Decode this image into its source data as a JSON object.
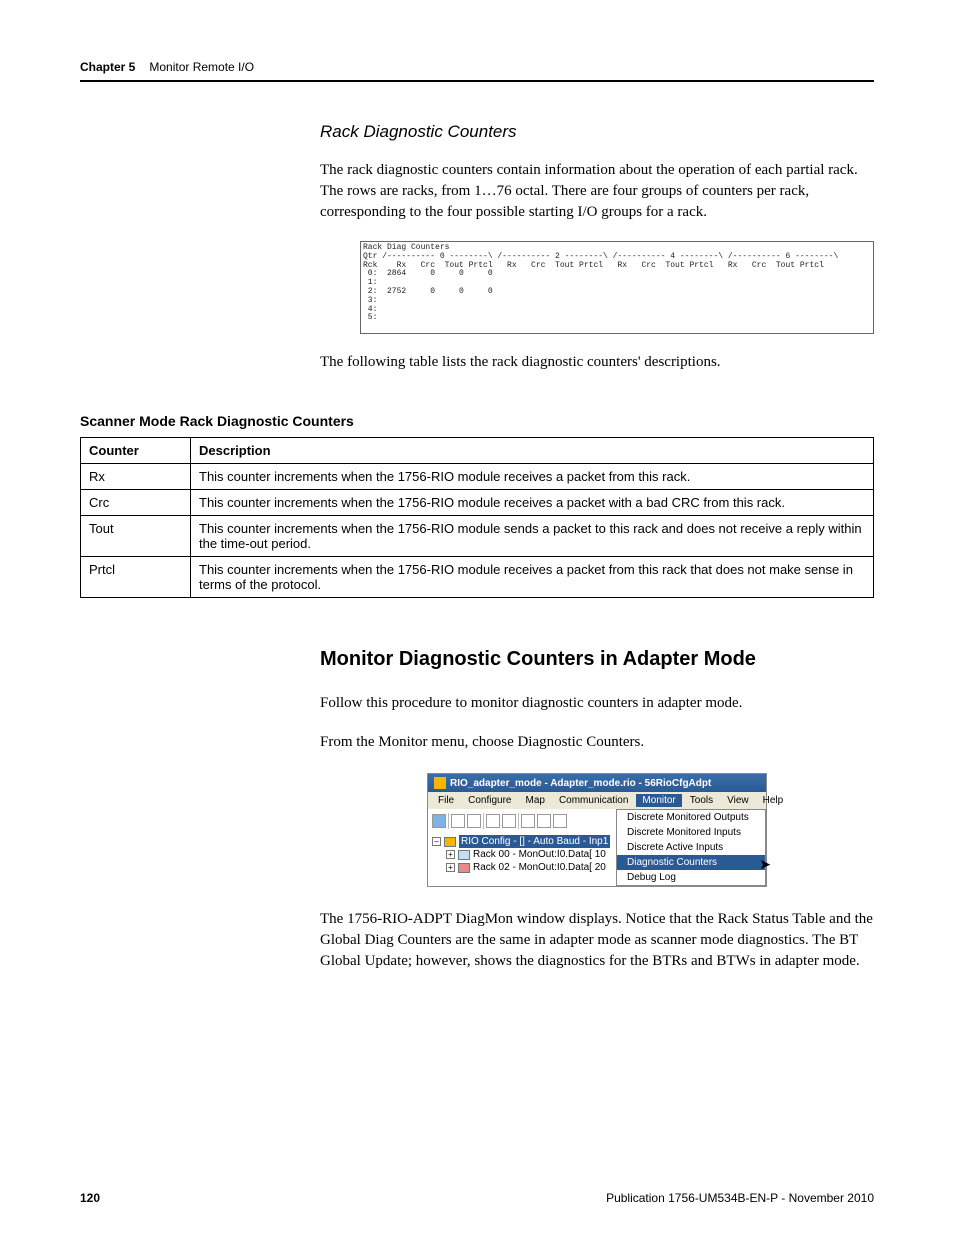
{
  "header": {
    "chapter": "Chapter 5",
    "title": "Monitor Remote I/O"
  },
  "section1": {
    "heading_italic": "Rack Diagnostic Counters",
    "para1": "The rack diagnostic counters contain information about the operation of each partial rack. The rows are racks, from 1…76 octal. There are four groups of counters per rack, corresponding to the four possible starting I/O groups for a rack.",
    "para2": "The following table lists the rack diagnostic counters' descriptions."
  },
  "rack_diag_shot": "Rack Diag Counters\nQtr /---------- 0 --------\\ /---------- 2 --------\\ /---------- 4 --------\\ /---------- 6 --------\\\nRck    Rx   Crc  Tout Prtcl   Rx   Crc  Tout Prtcl   Rx   Crc  Tout Prtcl   Rx   Crc  Tout Prtcl\n 0:  2864     0     0     0\n 1:\n 2:  2752     0     0     0\n 3:\n 4:\n 5:",
  "table": {
    "title": "Scanner Mode Rack Diagnostic Counters",
    "headers": [
      "Counter",
      "Description"
    ],
    "rows": [
      {
        "counter": "Rx",
        "desc": "This counter increments when the 1756-RIO module receives a packet from this rack."
      },
      {
        "counter": "Crc",
        "desc": "This counter increments when the 1756-RIO module receives a packet with a bad CRC from this rack."
      },
      {
        "counter": "Tout",
        "desc": "This counter increments when the 1756-RIO module sends a packet to this rack and does not receive a reply within the time-out period."
      },
      {
        "counter": "Prtcl",
        "desc": "This counter increments when the 1756-RIO module receives a packet from this rack that does not make sense in terms of the protocol."
      }
    ]
  },
  "section2": {
    "heading": "Monitor Diagnostic Counters in Adapter Mode",
    "para1": "Follow this procedure to monitor diagnostic counters in adapter mode.",
    "para2": "From the Monitor menu, choose Diagnostic Counters.",
    "para3": "The 1756-RIO-ADPT DiagMon window displays. Notice that the Rack Status Table and the Global Diag Counters are the same in adapter mode as scanner mode diagnostics. The BT Global Update; however, shows the diagnostics for the BTRs and BTWs in adapter mode."
  },
  "app": {
    "title": "RIO_adapter_mode - Adapter_mode.rio - 56RioCfgAdpt",
    "menu": [
      "File",
      "Configure",
      "Map",
      "Communication",
      "Monitor",
      "Tools",
      "View",
      "Help"
    ],
    "menu_selected": "Monitor",
    "tree": {
      "root": "RIO Config - [] - Auto Baud - Inp1",
      "children": [
        "Rack 00 - MonOut:I0.Data[ 10",
        "Rack 02 - MonOut:I0.Data[ 20"
      ]
    },
    "dropdown": {
      "items": [
        "Discrete Monitored Outputs",
        "Discrete Monitored Inputs",
        "Discrete Active Inputs",
        "Diagnostic Counters",
        "Debug Log"
      ],
      "highlighted": "Diagnostic Counters"
    }
  },
  "footer": {
    "page": "120",
    "pub": "Publication 1756-UM534B-EN-P - November 2010"
  }
}
